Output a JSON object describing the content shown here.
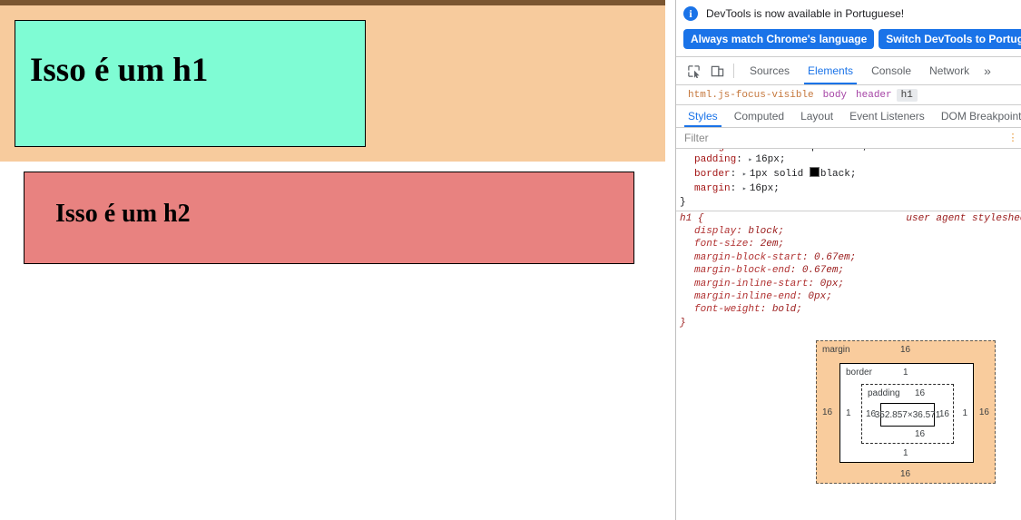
{
  "page": {
    "header_bg": "#f7cb9d",
    "h1": {
      "text": "Isso é um h1",
      "bg": "#7ffcd4",
      "border": "1px solid black"
    },
    "h2": {
      "text": "Isso é um h2",
      "bg": "#e88280",
      "border": "1px solid black"
    },
    "top_bar_color": "#7b5631"
  },
  "devtools": {
    "infobar": {
      "icon": "info-icon",
      "message": "DevTools is now available in Portuguese!",
      "buttons": [
        {
          "label": "Always match Chrome's language"
        },
        {
          "label": "Switch DevTools to Portuguese"
        }
      ]
    },
    "toolbar": {
      "icons": [
        {
          "name": "inspect-element-icon"
        },
        {
          "name": "device-toolbar-icon"
        }
      ],
      "tabs": [
        {
          "label": "Sources",
          "active": false
        },
        {
          "label": "Elements",
          "active": true
        },
        {
          "label": "Console",
          "active": false
        },
        {
          "label": "Network",
          "active": false
        }
      ],
      "more_label": "»"
    },
    "breadcrumb": [
      {
        "label": "html.js-focus-visible",
        "kind": "html",
        "selected": false
      },
      {
        "label": "body",
        "kind": "el",
        "selected": false
      },
      {
        "label": "header",
        "kind": "el",
        "selected": false
      },
      {
        "label": "h1",
        "kind": "el",
        "selected": true
      }
    ],
    "styles_tabs": [
      {
        "label": "Styles",
        "active": true
      },
      {
        "label": "Computed",
        "active": false
      },
      {
        "label": "Layout",
        "active": false
      },
      {
        "label": "Event Listeners",
        "active": false
      },
      {
        "label": "DOM Breakpoints",
        "active": false
      }
    ],
    "filter": {
      "placeholder": "Filter",
      "value": "",
      "kebab": "⋮"
    },
    "rules": {
      "author_rule": {
        "declarations": [
          {
            "prop": "padding",
            "value": "16px;",
            "expandable": true
          },
          {
            "prop": "border",
            "value": "1px solid",
            "swatch": "#000000",
            "swatch_name": "black;",
            "expandable": true
          },
          {
            "prop": "margin",
            "value": "16px;",
            "expandable": true
          }
        ],
        "close": "}"
      },
      "ua_rule": {
        "selector": "h1 {",
        "origin": "user agent stylesheet",
        "origin_visible": "use",
        "declarations": [
          {
            "prop": "display",
            "value": "block;"
          },
          {
            "prop": "font-size",
            "value": "2em;"
          },
          {
            "prop": "margin-block-start",
            "value": "0.67em;"
          },
          {
            "prop": "margin-block-end",
            "value": "0.67em;"
          },
          {
            "prop": "margin-inline-start",
            "value": "0px;"
          },
          {
            "prop": "margin-inline-end",
            "value": "0px;"
          },
          {
            "prop": "font-weight",
            "value": "bold;"
          }
        ],
        "close": "}"
      }
    },
    "box_model": {
      "margin": {
        "label": "margin",
        "top": "16",
        "right": "16",
        "bottom": "16",
        "left": "16"
      },
      "border": {
        "label": "border",
        "top": "1",
        "right": "1",
        "bottom": "1",
        "left": "1"
      },
      "padding": {
        "label": "padding",
        "top": "16",
        "right": "16",
        "bottom": "16",
        "left": "16"
      },
      "content": {
        "size": "352.857×36.571"
      },
      "margin_color": "#f9cc9d",
      "padding_color": "#ffffff",
      "content_color": "#ffffff"
    }
  }
}
